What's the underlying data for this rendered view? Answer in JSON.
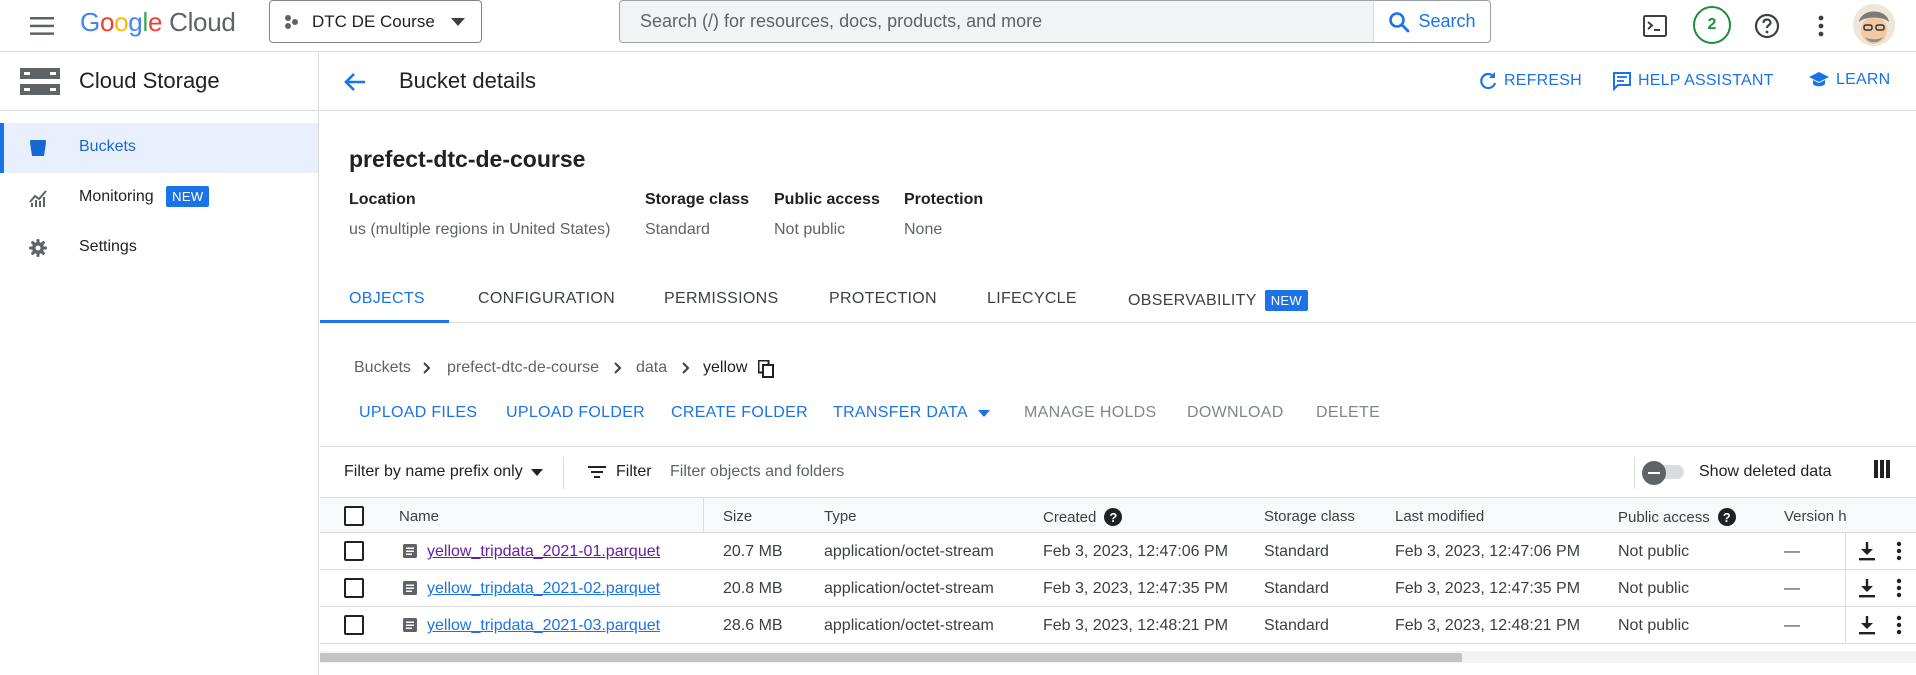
{
  "topbar": {
    "logo_google": "Google",
    "logo_cloud": "Cloud",
    "project_name": "DTC DE Course",
    "search_placeholder": "Search (/) for resources, docs, products, and more",
    "search_button": "Search",
    "notification_count": "2"
  },
  "sidebar": {
    "product_title": "Cloud Storage",
    "items": [
      {
        "label": "Buckets",
        "icon": "bucket-icon",
        "active": true
      },
      {
        "label": "Monitoring",
        "icon": "monitoring-icon",
        "badge": "NEW"
      },
      {
        "label": "Settings",
        "icon": "gear-icon"
      }
    ]
  },
  "header": {
    "title": "Bucket details",
    "actions": {
      "refresh": "REFRESH",
      "help_assistant": "HELP ASSISTANT",
      "learn": "LEARN"
    }
  },
  "bucket": {
    "name": "prefect-dtc-de-course",
    "info": [
      {
        "label": "Location",
        "value": "us (multiple regions in United States)"
      },
      {
        "label": "Storage class",
        "value": "Standard"
      },
      {
        "label": "Public access",
        "value": "Not public"
      },
      {
        "label": "Protection",
        "value": "None"
      }
    ]
  },
  "tabs": [
    {
      "label": "OBJECTS",
      "active": true
    },
    {
      "label": "CONFIGURATION"
    },
    {
      "label": "PERMISSIONS"
    },
    {
      "label": "PROTECTION"
    },
    {
      "label": "LIFECYCLE"
    },
    {
      "label": "OBSERVABILITY",
      "badge": "NEW"
    }
  ],
  "breadcrumb": [
    "Buckets",
    "prefect-dtc-de-course",
    "data",
    "yellow"
  ],
  "toolbar": {
    "upload_files": "UPLOAD FILES",
    "upload_folder": "UPLOAD FOLDER",
    "create_folder": "CREATE FOLDER",
    "transfer_data": "TRANSFER DATA",
    "manage_holds": "MANAGE HOLDS",
    "download": "DOWNLOAD",
    "delete": "DELETE"
  },
  "filterbar": {
    "prefix_select": "Filter by name prefix only",
    "filter_label": "Filter",
    "filter_placeholder": "Filter objects and folders",
    "show_deleted": "Show deleted data",
    "show_deleted_on": false
  },
  "table": {
    "columns": [
      "Name",
      "Size",
      "Type",
      "Created",
      "Storage class",
      "Last modified",
      "Public access",
      "Version h"
    ],
    "rows": [
      {
        "name": "yellow_tripdata_2021-01.parquet",
        "size": "20.7 MB",
        "type": "application/octet-stream",
        "created": "Feb 3, 2023, 12:47:06 PM",
        "storage_class": "Standard",
        "last_modified": "Feb 3, 2023, 12:47:06 PM",
        "public_access": "Not public",
        "version": "—",
        "visited": true
      },
      {
        "name": "yellow_tripdata_2021-02.parquet",
        "size": "20.8 MB",
        "type": "application/octet-stream",
        "created": "Feb 3, 2023, 12:47:35 PM",
        "storage_class": "Standard",
        "last_modified": "Feb 3, 2023, 12:47:35 PM",
        "public_access": "Not public",
        "version": "—",
        "visited": false
      },
      {
        "name": "yellow_tripdata_2021-03.parquet",
        "size": "28.6 MB",
        "type": "application/octet-stream",
        "created": "Feb 3, 2023, 12:48:21 PM",
        "storage_class": "Standard",
        "last_modified": "Feb 3, 2023, 12:48:21 PM",
        "public_access": "Not public",
        "version": "—",
        "visited": false
      }
    ]
  },
  "colors": {
    "accent": "#1a73e8",
    "active_nav_bg": "#e8f0fe",
    "status_green": "#1e8e3e",
    "visited_link": "#681da8"
  }
}
